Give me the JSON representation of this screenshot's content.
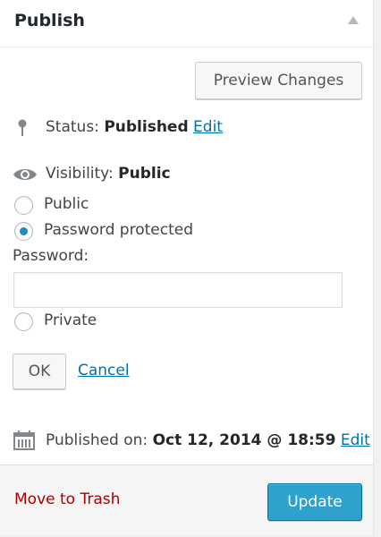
{
  "publish_box": {
    "title": "Publish",
    "preview_button": "Preview Changes",
    "status": {
      "label": "Status:",
      "value": "Published",
      "edit": "Edit"
    },
    "visibility": {
      "label": "Visibility:",
      "value": "Public",
      "options": [
        {
          "label": "Public",
          "checked": false
        },
        {
          "label": "Password protected",
          "checked": true
        },
        {
          "label": "Private",
          "checked": false
        }
      ],
      "password_label": "Password:",
      "password_value": "",
      "ok_button": "OK",
      "cancel_link": "Cancel"
    },
    "published_on": {
      "label": "Published on:",
      "value": "Oct 12, 2014 @ 18:59",
      "edit": "Edit"
    },
    "trash_link": "Move to Trash",
    "update_button": "Update"
  },
  "colors": {
    "primary": "#2ea2cc",
    "link": "#0073aa",
    "danger": "#aa0000"
  },
  "icons": {
    "status": "pin-icon",
    "visibility": "eye-icon",
    "date": "calendar-icon",
    "toggle": "triangle-up-icon"
  }
}
